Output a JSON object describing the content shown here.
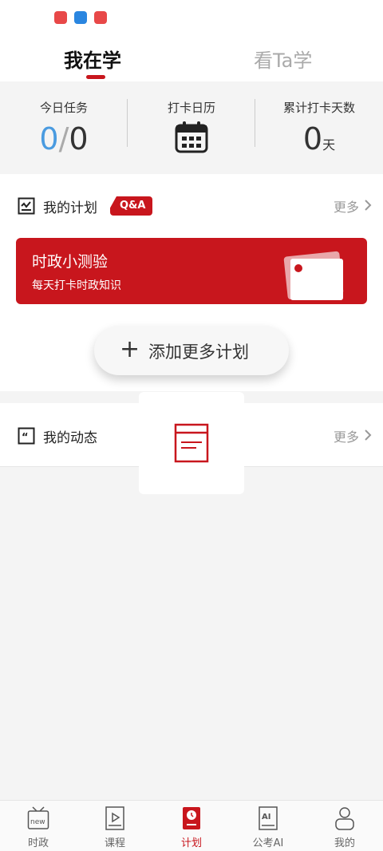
{
  "top_tabs": {
    "active": "我在学",
    "other": "看Ta学"
  },
  "stats": {
    "today_label": "今日任务",
    "today_done": "0",
    "today_sep": "/",
    "today_total": "0",
    "calendar_label": "打卡日历",
    "days_label": "累计打卡天数",
    "days_value": "0",
    "days_unit": "天"
  },
  "plans": {
    "title": "我的计划",
    "badge": "Q&A",
    "more": "更多",
    "banner_title": "时政小测验",
    "banner_sub": "每天打卡时政知识",
    "add_button": "添加更多计划"
  },
  "feed": {
    "title": "我的动态",
    "more": "更多"
  },
  "bottom_nav": [
    {
      "label": "时政",
      "icon": "news-tv-icon"
    },
    {
      "label": "课程",
      "icon": "course-book-icon"
    },
    {
      "label": "计划",
      "icon": "plan-clock-icon"
    },
    {
      "label": "公考AI",
      "icon": "ai-book-icon"
    },
    {
      "label": "我的",
      "icon": "profile-icon"
    }
  ],
  "colors": {
    "brand": "#c8161d",
    "accent_blue": "#4a9be0"
  }
}
